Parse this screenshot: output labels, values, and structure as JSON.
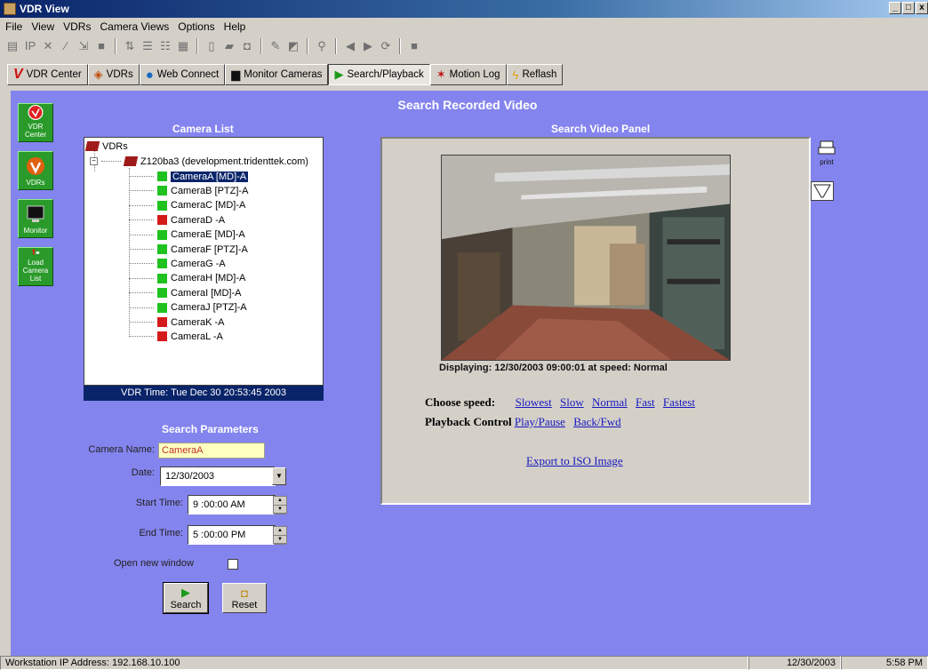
{
  "window": {
    "title": "VDR View",
    "controls": [
      "_",
      "□",
      "x"
    ]
  },
  "menu": [
    "File",
    "View",
    "VDRs",
    "Camera Views",
    "Options",
    "Help"
  ],
  "tabs": [
    {
      "label": "VDR Center",
      "icon": "v-logo-icon"
    },
    {
      "label": "VDRs",
      "icon": "vdrs-icon"
    },
    {
      "label": "Web Connect",
      "icon": "globe-icon"
    },
    {
      "label": "Monitor Cameras",
      "icon": "monitor-icon"
    },
    {
      "label": "Search/Playback",
      "icon": "search-playback-icon",
      "active": true
    },
    {
      "label": "Motion Log",
      "icon": "motion-icon"
    },
    {
      "label": "Reflash",
      "icon": "lightning-icon"
    }
  ],
  "nav": [
    {
      "label": "VDR Center",
      "icon": "vdr-center-icon"
    },
    {
      "label": "VDRs",
      "icon": "vdrs-icon"
    },
    {
      "label": "Monitor",
      "icon": "monitor-icon"
    },
    {
      "label": "Load Camera List",
      "icon": "load-camera-list-icon"
    }
  ],
  "page_title": "Search Recorded Video",
  "camera_list": {
    "title": "Camera List",
    "root": "VDRs",
    "server": "Z120ba3 (development.tridenttek.com)",
    "cameras": [
      {
        "name": "CameraA [MD]-A",
        "status": "green",
        "selected": true
      },
      {
        "name": "CameraB [PTZ]-A",
        "status": "green"
      },
      {
        "name": "CameraC [MD]-A",
        "status": "green"
      },
      {
        "name": "CameraD -A",
        "status": "red"
      },
      {
        "name": "CameraE [MD]-A",
        "status": "green"
      },
      {
        "name": "CameraF [PTZ]-A",
        "status": "green"
      },
      {
        "name": "CameraG -A",
        "status": "green"
      },
      {
        "name": "CameraH [MD]-A",
        "status": "green"
      },
      {
        "name": "CameraI [MD]-A",
        "status": "green"
      },
      {
        "name": "CameraJ [PTZ]-A",
        "status": "green"
      },
      {
        "name": "CameraK -A",
        "status": "red"
      },
      {
        "name": "CameraL -A",
        "status": "red"
      }
    ],
    "vdr_time": "VDR Time: Tue Dec 30 20:53:45 2003"
  },
  "search_params": {
    "title": "Search Parameters",
    "camera_name_label": "Camera Name:",
    "camera_name": "CameraA",
    "date_label": "Date:",
    "date": "12/30/2003",
    "start_label": "Start Time:",
    "start_time": "9 :00:00 AM",
    "end_label": "End Time:",
    "end_time": "5 :00:00 PM",
    "new_window_label": "Open new window",
    "search_label": "Search",
    "reset_label": "Reset"
  },
  "video_panel": {
    "title": "Search Video Panel",
    "displaying": "Displaying: 12/30/2003 09:00:01 at speed: Normal",
    "choose_speed_label": "Choose speed:",
    "speeds": [
      "Slowest",
      "Slow",
      "Normal",
      "Fast",
      "Fastest"
    ],
    "playback_label": "Playback Control",
    "playback_links": [
      "Play/Pause",
      "Back/Fwd"
    ],
    "export_link": "Export to ISO Image",
    "print_label": "print"
  },
  "status": {
    "ip": "Workstation IP Address: 192.168.10.100",
    "date": "12/30/2003",
    "time": "5:58 PM"
  }
}
